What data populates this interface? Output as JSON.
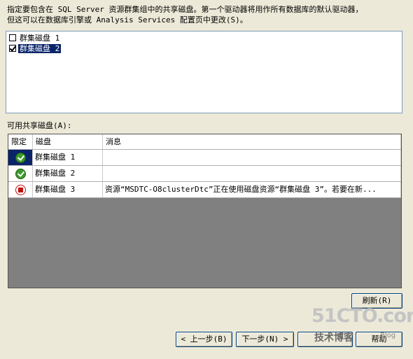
{
  "instructions": "指定要包含在 SQL Server 资源群集组中的共享磁盘。第一个驱动器将用作所有数据库的默认驱动器，\n但这可以在数据库引擎或 Analysis Services 配置页中更改(S)。",
  "disk_list": [
    {
      "label": "群集磁盘 1",
      "checked": false,
      "selected": false
    },
    {
      "label": "群集磁盘 2",
      "checked": true,
      "selected": true
    }
  ],
  "available_label": "可用共享磁盘(A):",
  "grid": {
    "headers": [
      "限定",
      "磁盘",
      "消息"
    ],
    "rows": [
      {
        "status_icon": "ok-icon",
        "disk": "群集磁盘 1",
        "message": ""
      },
      {
        "status_icon": "ok-icon",
        "disk": "群集磁盘 2",
        "message": ""
      },
      {
        "status_icon": "stop-icon",
        "disk": "群集磁盘 3",
        "message": "资源“MSDTC-O8clusterDtc”正在使用磁盘资源“群集磁盘 3”。若要在新..."
      }
    ]
  },
  "buttons": {
    "refresh": "刷新(R)",
    "back": "< 上一步(B)",
    "next": "下一步(N) >",
    "help": "帮助"
  },
  "watermark": {
    "main": "51CTO.com",
    "sub": "技术博客",
    "blog": "Blog"
  }
}
